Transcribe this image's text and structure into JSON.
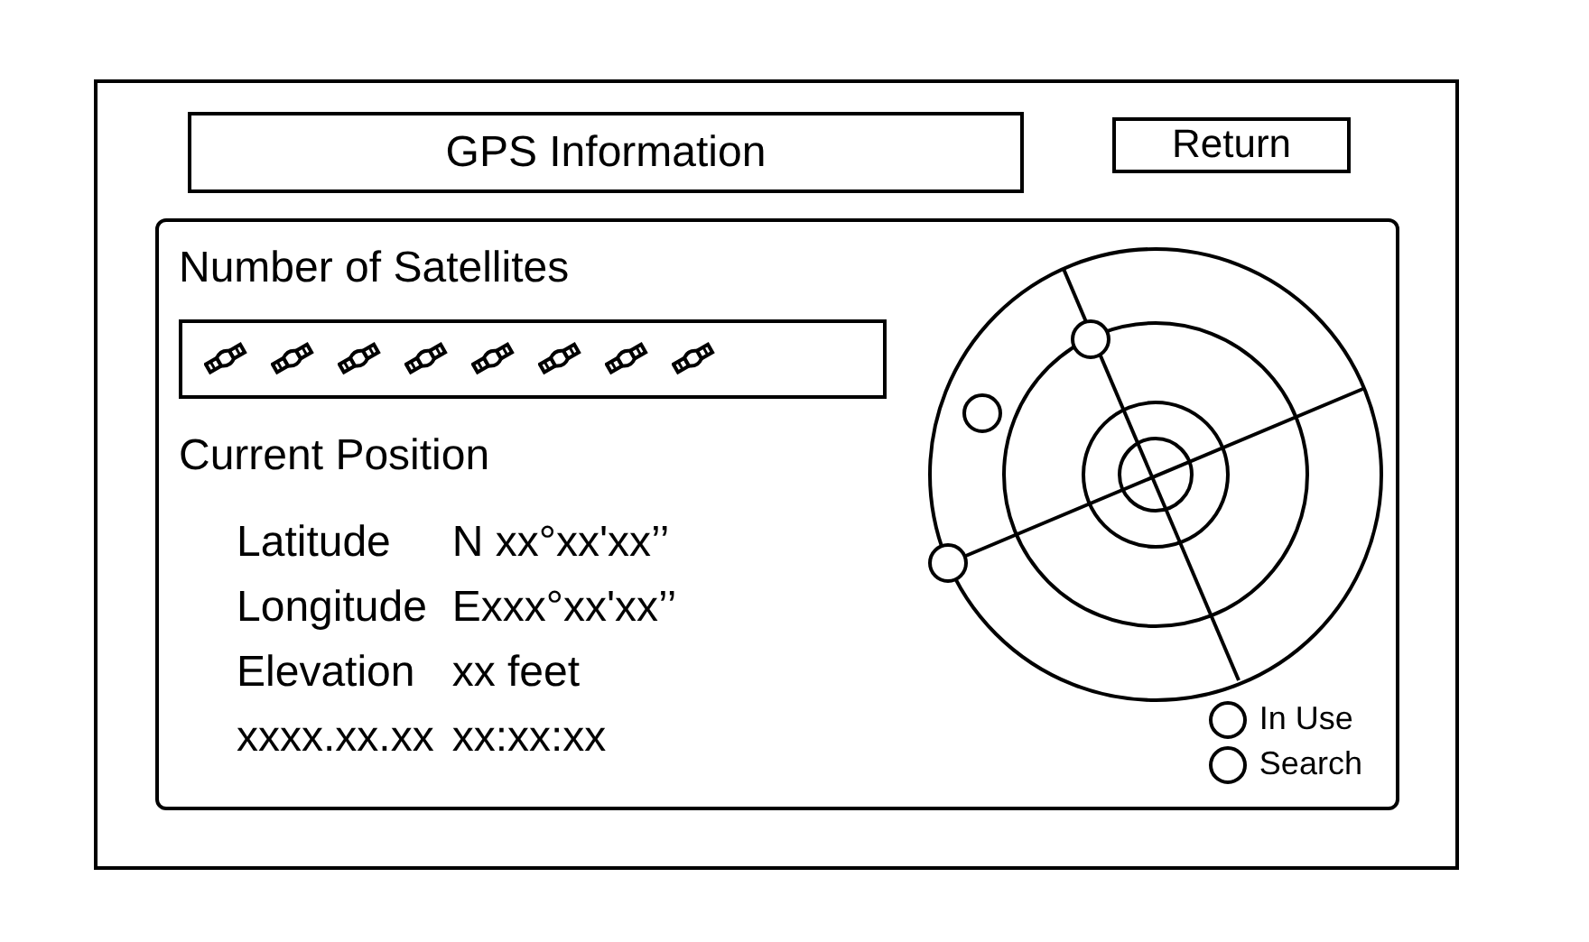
{
  "title": "GPS Information",
  "return_button": "Return",
  "satellites_section": {
    "heading": "Number of Satellites",
    "satellites": [
      {
        "kind": "satellite"
      },
      {
        "kind": "satellite"
      },
      {
        "kind": "satellite"
      },
      {
        "kind": "satellite"
      },
      {
        "kind": "satellite"
      },
      {
        "kind": "satellite"
      },
      {
        "kind": "satellite"
      },
      {
        "kind": "satellite"
      }
    ]
  },
  "position": {
    "heading": "Current Position",
    "rows": [
      {
        "label": "Latitude",
        "value": "N xx°xx'xx’’"
      },
      {
        "label": "Longitude",
        "value": "Exxx°xx'xx’’"
      },
      {
        "label": "Elevation",
        "value": "xx feet"
      },
      {
        "label": "xxxx.xx.xx",
        "value": "xx:xx:xx"
      }
    ]
  },
  "legend": [
    "In Use",
    "Search"
  ]
}
